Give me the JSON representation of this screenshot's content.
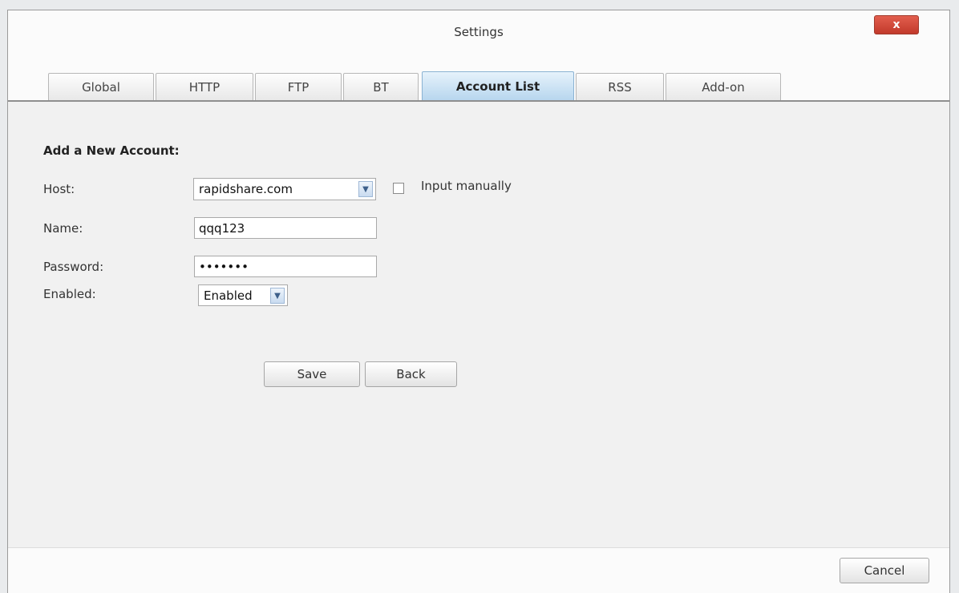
{
  "window": {
    "title": "Settings",
    "close_label": "x"
  },
  "tabs": [
    {
      "label": "Global",
      "active": false
    },
    {
      "label": "HTTP",
      "active": false
    },
    {
      "label": "FTP",
      "active": false
    },
    {
      "label": "BT",
      "active": false
    },
    {
      "label": "Account List",
      "active": true
    },
    {
      "label": "RSS",
      "active": false
    },
    {
      "label": "Add-on",
      "active": false
    }
  ],
  "form": {
    "section_title": "Add a New Account:",
    "host_label": "Host:",
    "host_value": "rapidshare.com",
    "input_manually_label": "Input manually",
    "name_label": "Name:",
    "name_value": "qqq123",
    "password_label": "Password:",
    "password_value": "•••••••",
    "enabled_label": "Enabled:",
    "enabled_value": "Enabled"
  },
  "buttons": {
    "save": "Save",
    "back": "Back",
    "cancel": "Cancel"
  },
  "icons": {
    "dropdown": "chevron-down-icon",
    "close": "close-icon"
  },
  "colors": {
    "active_tab": "#b7d6ee",
    "close_button": "#c23a2b"
  }
}
